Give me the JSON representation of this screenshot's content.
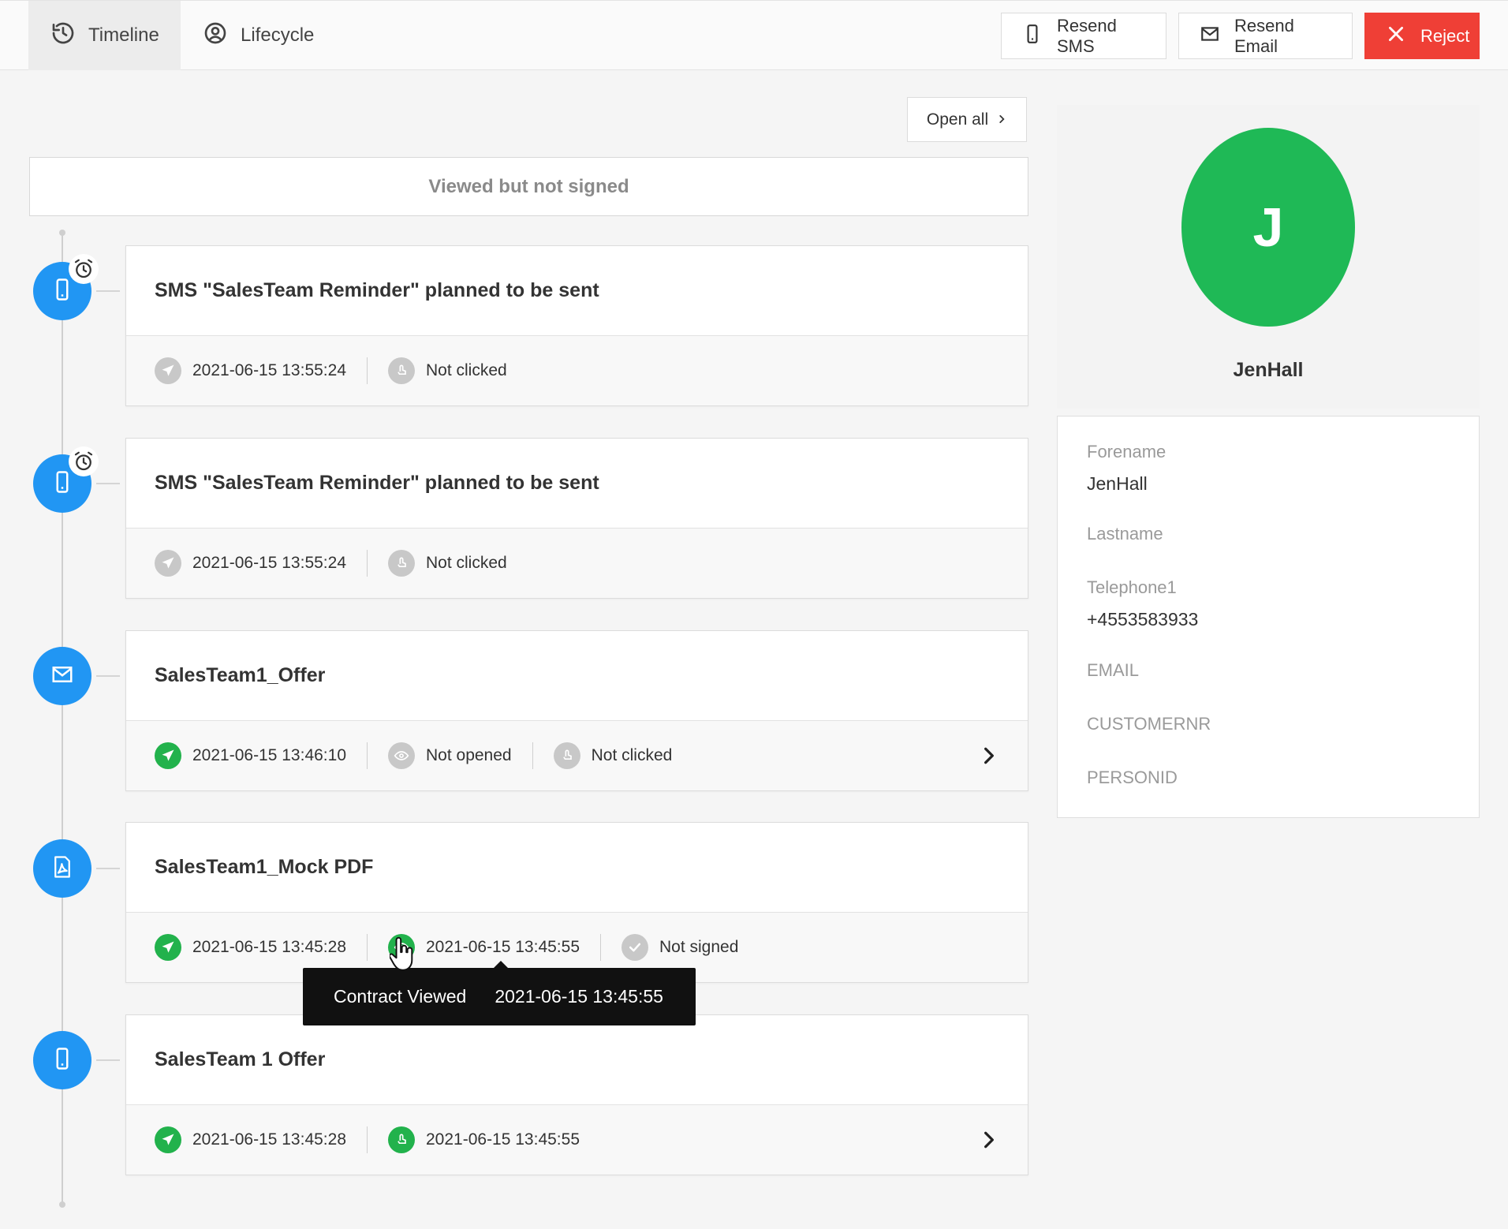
{
  "tabs": [
    {
      "label": "Timeline",
      "icon": "history-icon",
      "active": true
    },
    {
      "label": "Lifecycle",
      "icon": "user-circle-icon",
      "active": false
    }
  ],
  "actions": {
    "resend_sms": "Resend SMS",
    "resend_email": "Resend Email",
    "reject": "Reject"
  },
  "open_all": "Open all",
  "status": "Viewed but not signed",
  "timeline": [
    {
      "type": "sms",
      "scheduled": true,
      "title": "SMS \"SalesTeam Reminder\" planned to be sent",
      "meta": [
        {
          "icon": "send-icon",
          "state": "grey",
          "text": "2021-06-15 13:55:24"
        },
        {
          "icon": "click-icon",
          "state": "grey",
          "text": "Not clicked"
        }
      ]
    },
    {
      "type": "sms",
      "scheduled": true,
      "title": "SMS \"SalesTeam Reminder\" planned to be sent",
      "meta": [
        {
          "icon": "send-icon",
          "state": "grey",
          "text": "2021-06-15 13:55:24"
        },
        {
          "icon": "click-icon",
          "state": "grey",
          "text": "Not clicked"
        }
      ]
    },
    {
      "type": "email",
      "scheduled": false,
      "title": "SalesTeam1_Offer",
      "expandable": true,
      "meta": [
        {
          "icon": "send-icon",
          "state": "green",
          "text": "2021-06-15 13:46:10"
        },
        {
          "icon": "eye-icon",
          "state": "grey",
          "text": "Not opened"
        },
        {
          "icon": "click-icon",
          "state": "grey",
          "text": "Not clicked"
        }
      ]
    },
    {
      "type": "pdf",
      "scheduled": false,
      "title": "SalesTeam1_Mock PDF",
      "meta": [
        {
          "icon": "send-icon",
          "state": "green",
          "text": "2021-06-15 13:45:28"
        },
        {
          "icon": "eye-icon",
          "state": "green",
          "text": "2021-06-15 13:45:55"
        },
        {
          "icon": "check-icon",
          "state": "grey",
          "text": "Not signed"
        }
      ]
    },
    {
      "type": "sms",
      "scheduled": false,
      "title": "SalesTeam 1 Offer",
      "expandable": true,
      "meta": [
        {
          "icon": "send-icon",
          "state": "green",
          "text": "2021-06-15 13:45:28"
        },
        {
          "icon": "click-icon",
          "state": "green",
          "text": "2021-06-15 13:45:55"
        }
      ]
    }
  ],
  "tooltip": {
    "label": "Contract Viewed",
    "value": "2021-06-15 13:45:55"
  },
  "profile": {
    "initial": "J",
    "name": "JenHall",
    "avatar_color": "#1fb956"
  },
  "fields": [
    {
      "label": "Forename",
      "value": "JenHall"
    },
    {
      "label": "Lastname",
      "value": ""
    },
    {
      "label": "Telephone1",
      "value": "+4553583933"
    },
    {
      "label": "EMAIL",
      "value": ""
    },
    {
      "label": "CUSTOMERNR",
      "value": ""
    },
    {
      "label": "PERSONID",
      "value": ""
    }
  ],
  "colors": {
    "accent_blue": "#2196f3",
    "success_green": "#22b24c",
    "reject_red": "#ef3f36"
  }
}
